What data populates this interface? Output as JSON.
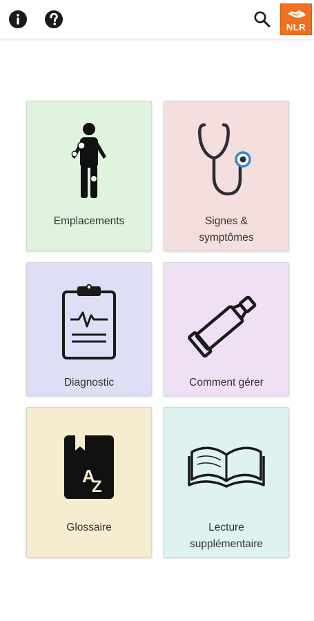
{
  "toolbar": {
    "info_icon": "info-icon",
    "help_icon": "help-icon",
    "search_icon": "search-icon",
    "logo_text": "NLR"
  },
  "colors": {
    "logo_orange": "#f0701f",
    "card_green": "#dff3df",
    "card_pink": "#f5dede",
    "card_lavender": "#dedff5",
    "card_purple": "#efe0f5",
    "card_yellow": "#f6ecd0",
    "card_cyan": "#dff2f2",
    "accent_blue": "#2f8ad8"
  },
  "menu": {
    "items": [
      {
        "label_1": "Emplacements",
        "label_2": "",
        "icon": "body-locations-icon"
      },
      {
        "label_1": "Signes &",
        "label_2": "symptômes",
        "icon": "stethoscope-icon"
      },
      {
        "label_1": "Diagnostic",
        "label_2": "",
        "icon": "clipboard-ecg-icon"
      },
      {
        "label_1": "Comment gérer",
        "label_2": "",
        "icon": "ointment-tube-icon"
      },
      {
        "label_1": "Glossaire",
        "label_2": "",
        "icon": "glossary-book-icon"
      },
      {
        "label_1": "Lecture",
        "label_2": "supplémentaire",
        "icon": "open-book-icon"
      }
    ]
  }
}
